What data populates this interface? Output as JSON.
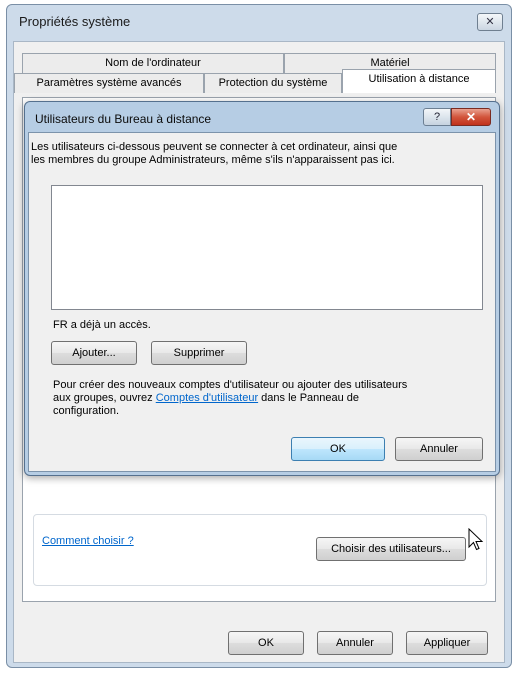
{
  "window": {
    "title": "Propriétés système",
    "close_glyph": "✕"
  },
  "tabs": {
    "row_back": [
      "Nom de l'ordinateur",
      "Matériel"
    ],
    "row_front": [
      "Paramètres système avancés",
      "Protection du système",
      "Utilisation à distance"
    ],
    "active": "Utilisation à distance"
  },
  "remote_panel": {
    "help_link": "Comment choisir ?",
    "choose_users_button": "Choisir des utilisateurs..."
  },
  "footer": {
    "ok_label": "OK",
    "cancel_label": "Annuler",
    "apply_label": "Appliquer"
  },
  "dialog": {
    "title": "Utilisateurs du Bureau à distance",
    "help_glyph": "?",
    "close_glyph": "✕",
    "description_line1": "Les utilisateurs ci-dessous peuvent se connecter à cet ordinateur, ainsi que",
    "description_line2": "les membres du groupe Administrateurs, même s'ils n'apparaissent pas ici.",
    "users": [],
    "access_text": "FR a déjà un accès.",
    "add_label": "Ajouter...",
    "remove_label": "Supprimer",
    "info_line1": "Pour créer des nouveaux comptes d'utilisateur ou ajouter des utilisateurs",
    "info_line2_prefix": "aux groupes, ouvrez ",
    "info_link": "Comptes d'utilisateur",
    "info_line2_suffix": " dans le Panneau de",
    "info_line3": "configuration.",
    "ok_label": "OK",
    "cancel_label": "Annuler"
  }
}
